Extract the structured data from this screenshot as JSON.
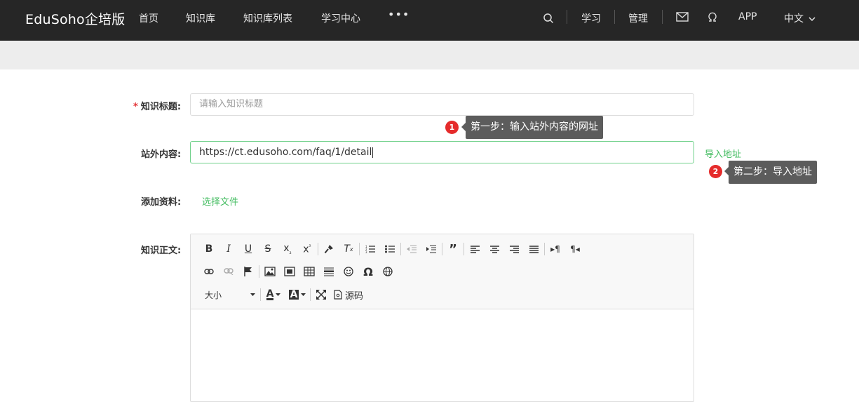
{
  "nav": {
    "brand": "EduSoho企培版",
    "items": [
      "首页",
      "知识库",
      "知识库列表",
      "学习中心"
    ],
    "more": "•••",
    "right": {
      "study": "学习",
      "manage": "管理",
      "app": "APP",
      "lang": "中文"
    }
  },
  "form": {
    "title_label": "知识标题:",
    "title_required": "*",
    "title_placeholder": "请输入知识标题",
    "external_label": "站外内容:",
    "external_value": "https://ct.edusoho.com/faq/1/detail",
    "import_link": "导入地址",
    "attach_label": "添加资料:",
    "choose_file": "选择文件",
    "body_label": "知识正文:"
  },
  "tips": {
    "step1_num": "1",
    "step1_text": "第一步：输入站外内容的网址",
    "step2_num": "2",
    "step2_text": "第二步：导入地址"
  },
  "editor": {
    "font_size_label": "大小",
    "source_label": "源码"
  },
  "colors": {
    "accent": "#43bc60",
    "nav_bg": "#262626",
    "tip_bg": "#5c5c5c",
    "badge": "#e52b2b"
  }
}
